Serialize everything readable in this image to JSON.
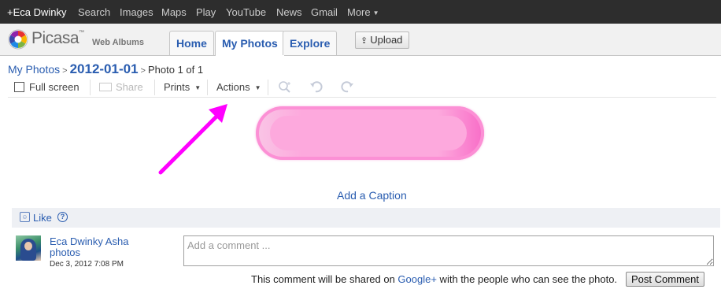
{
  "google_bar": {
    "user": "+Eca Dwinky",
    "items": [
      "Search",
      "Images",
      "Maps",
      "Play",
      "YouTube",
      "News",
      "Gmail"
    ],
    "more": "More"
  },
  "header": {
    "logo_word": "Picasa",
    "logo_tm": "™",
    "logo_sub": "Web Albums",
    "tabs": [
      "Home",
      "My Photos",
      "Explore"
    ],
    "active_tab": "My Photos",
    "upload": "Upload"
  },
  "breadcrumb": {
    "root": "My Photos",
    "separator": ">",
    "album": "2012-01-01",
    "photo_count": "Photo 1 of 1"
  },
  "toolbar": {
    "full_screen": "Full screen",
    "share": "Share",
    "prints": "Prints",
    "actions": "Actions",
    "zoom_icon": "zoom-in-icon",
    "rotate_left_icon": "rotate-left-icon",
    "rotate_right_icon": "rotate-right-icon"
  },
  "photo": {
    "colors": {
      "main": "#fda9dd",
      "edge": "#f86cc7"
    }
  },
  "annotation": {
    "arrow_color": "#ff00ff"
  },
  "caption": {
    "add": "Add a Caption"
  },
  "like": {
    "label": "Like",
    "help": "?"
  },
  "comment": {
    "author_name": "Eca Dwinky Asha",
    "author_sub": "photos",
    "date": "Dec 3, 2012 7:08 PM",
    "placeholder": "Add a comment ...",
    "share_prefix": "This comment will be shared on ",
    "share_link": "Google+",
    "share_suffix": " with the people who can see the photo.",
    "post_button": "Post Comment"
  }
}
